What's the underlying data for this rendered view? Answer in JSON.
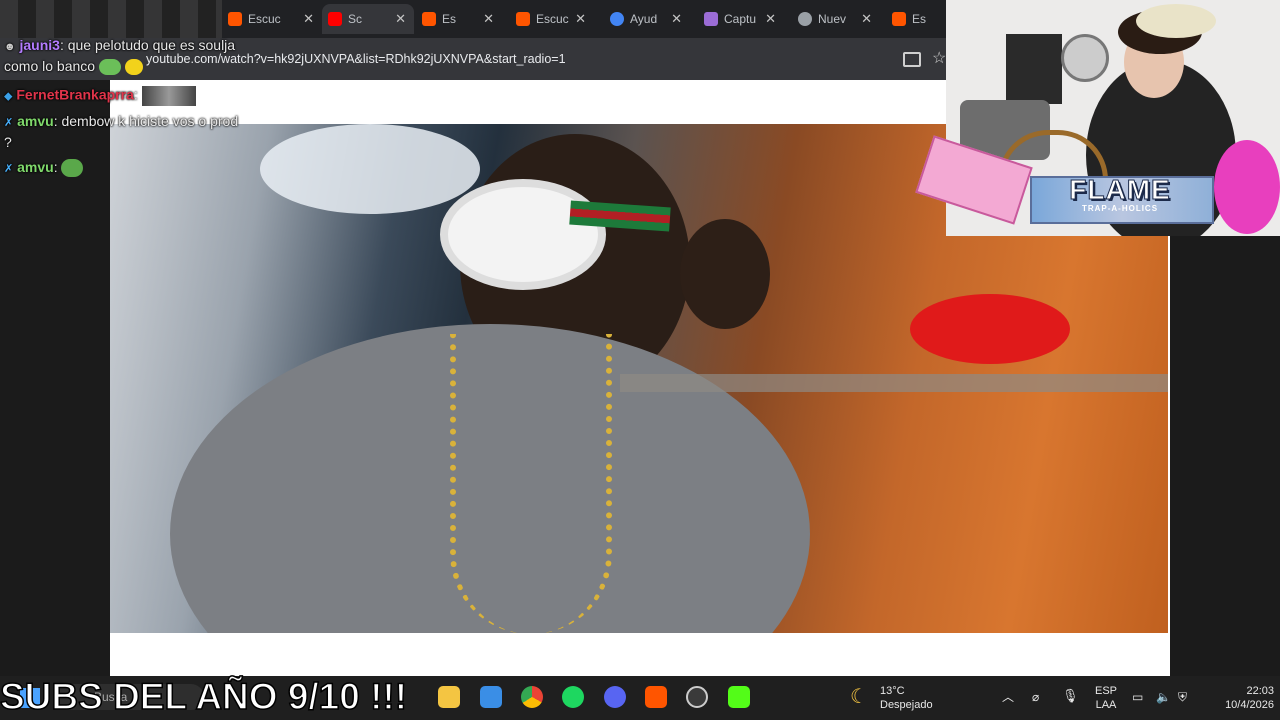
{
  "browser": {
    "tabs": [
      {
        "label": "Escuc",
        "color": "#ff5500"
      },
      {
        "label": "Sc",
        "color": "#ff0000"
      },
      {
        "label": "Es",
        "color": "#ff5500"
      },
      {
        "label": "Escuc",
        "color": "#ff5500"
      },
      {
        "label": "Ayud",
        "color": "#4285f4"
      },
      {
        "label": "Captu",
        "color": "#9b6cd6"
      },
      {
        "label": "Nuev",
        "color": "#9aa0a6"
      },
      {
        "label": "Es",
        "color": "#ff5500"
      }
    ],
    "close_glyph": "✕",
    "url": "youtube.com/watch?v=hk92jUXNVPA&list=RDhk92jUXNVPA&start_radio=1"
  },
  "chat": {
    "messages": [
      {
        "user": "jauni3",
        "user_color": "#b47cff",
        "text": ": que pelotudo que es soulja"
      },
      {
        "user": "",
        "user_color": "#ffffff",
        "text": "como lo banco"
      },
      {
        "user": "FernetBrankaprra",
        "user_color": "#e0344a",
        "text": ":"
      },
      {
        "user": "amvu",
        "user_color": "#7fd86b",
        "text": ": dembow k hiciste vos o prod"
      },
      {
        "user": "",
        "user_color": "#ffffff",
        "text": "?"
      },
      {
        "user": "amvu",
        "user_color": "#7fd86b",
        "text": ":"
      }
    ]
  },
  "overlay": {
    "brand": "FLAME",
    "brand_sub": "TRAP-A-HOLICS",
    "subs_text": "SUBS DEL AÑO 9/10 !!!"
  },
  "taskbar": {
    "search_hint": "Busca",
    "weather_temp": "13°C",
    "weather_desc": "Despejado",
    "lang_top": "ESP",
    "lang_bottom": "LAA",
    "time": "22:03",
    "date": "10/4/2026"
  }
}
